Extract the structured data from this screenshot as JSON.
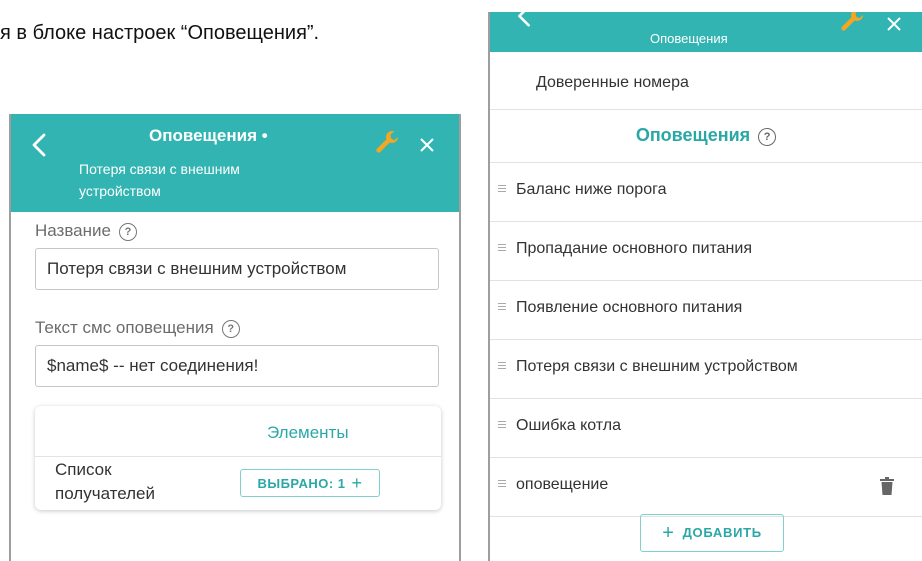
{
  "doc": {
    "caption_fragment": "я в блоке настроек “Оповещения”."
  },
  "left": {
    "header": {
      "title": "Оповещения •",
      "subtitle": "Потеря связи с внешним устройством"
    },
    "name_field": {
      "label": "Название",
      "value": "Потеря связи с внешним устройством"
    },
    "sms_field": {
      "label": "Текст смс оповещения",
      "value": "$name$ -- нет соединения!"
    },
    "elements_card": {
      "tab": "Элементы",
      "recipients_label": "Список получателей",
      "selected_button": "ВЫБРАНО: 1"
    },
    "help_glyph": "?"
  },
  "right": {
    "header": {
      "subtitle": "Оповещения"
    },
    "trusted_numbers": "Доверенные номера",
    "section_title": "Оповещения",
    "items": [
      {
        "label": "Баланс ниже порога"
      },
      {
        "label": "Пропадание основного питания"
      },
      {
        "label": "Появление основного питания"
      },
      {
        "label": "Потеря связи с внешним устройством"
      },
      {
        "label": "Ошибка котла"
      },
      {
        "label": "оповещение"
      }
    ],
    "add_button": "ДОБАВИТЬ"
  },
  "colors": {
    "header": "#32b4b2",
    "accent": "#2aa8a6",
    "wrench": "#f5a623"
  },
  "icons": [
    "back-arrow-icon",
    "wrench-icon",
    "close-icon",
    "help-icon",
    "drag-handle-icon",
    "trash-icon",
    "plus-icon"
  ]
}
